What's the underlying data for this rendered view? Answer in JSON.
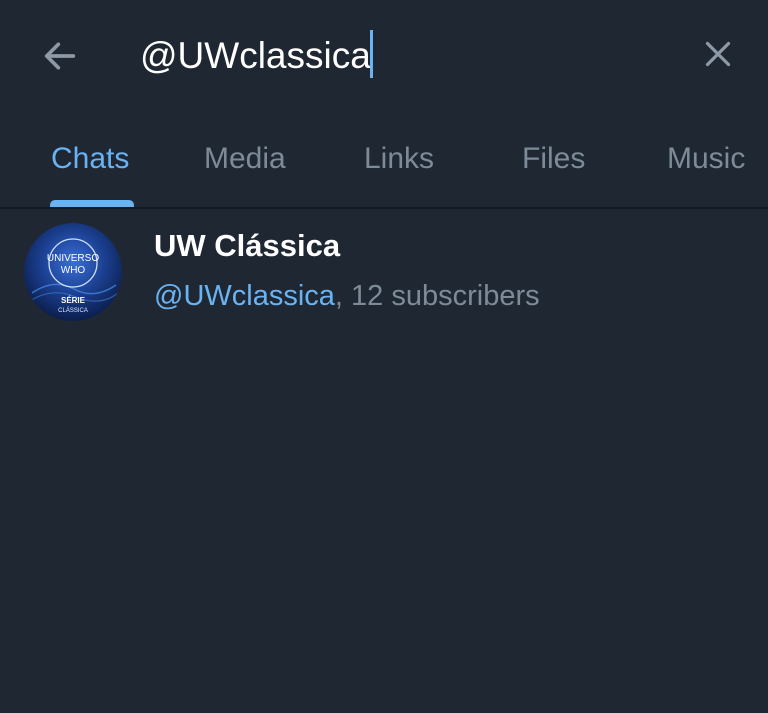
{
  "search": {
    "value": "@UWclassica",
    "back_icon": "arrow-left-icon",
    "clear_icon": "close-icon"
  },
  "tabs": [
    {
      "label": "Chats",
      "active": true
    },
    {
      "label": "Media",
      "active": false
    },
    {
      "label": "Links",
      "active": false
    },
    {
      "label": "Files",
      "active": false
    },
    {
      "label": "Music",
      "active": false
    }
  ],
  "results": [
    {
      "title": "UW Clássica",
      "handle": "@UWclassica",
      "separator": ",",
      "subscribers": " 12 subscribers",
      "avatar": {
        "line1": "UNIVERSO",
        "line2": "WHO",
        "line3": "SÉRIE",
        "line4": "CLÁSSICA"
      }
    }
  ],
  "colors": {
    "background": "#1f2733",
    "accent": "#6ab3f3",
    "muted": "#7d8b99",
    "text": "#ffffff"
  }
}
